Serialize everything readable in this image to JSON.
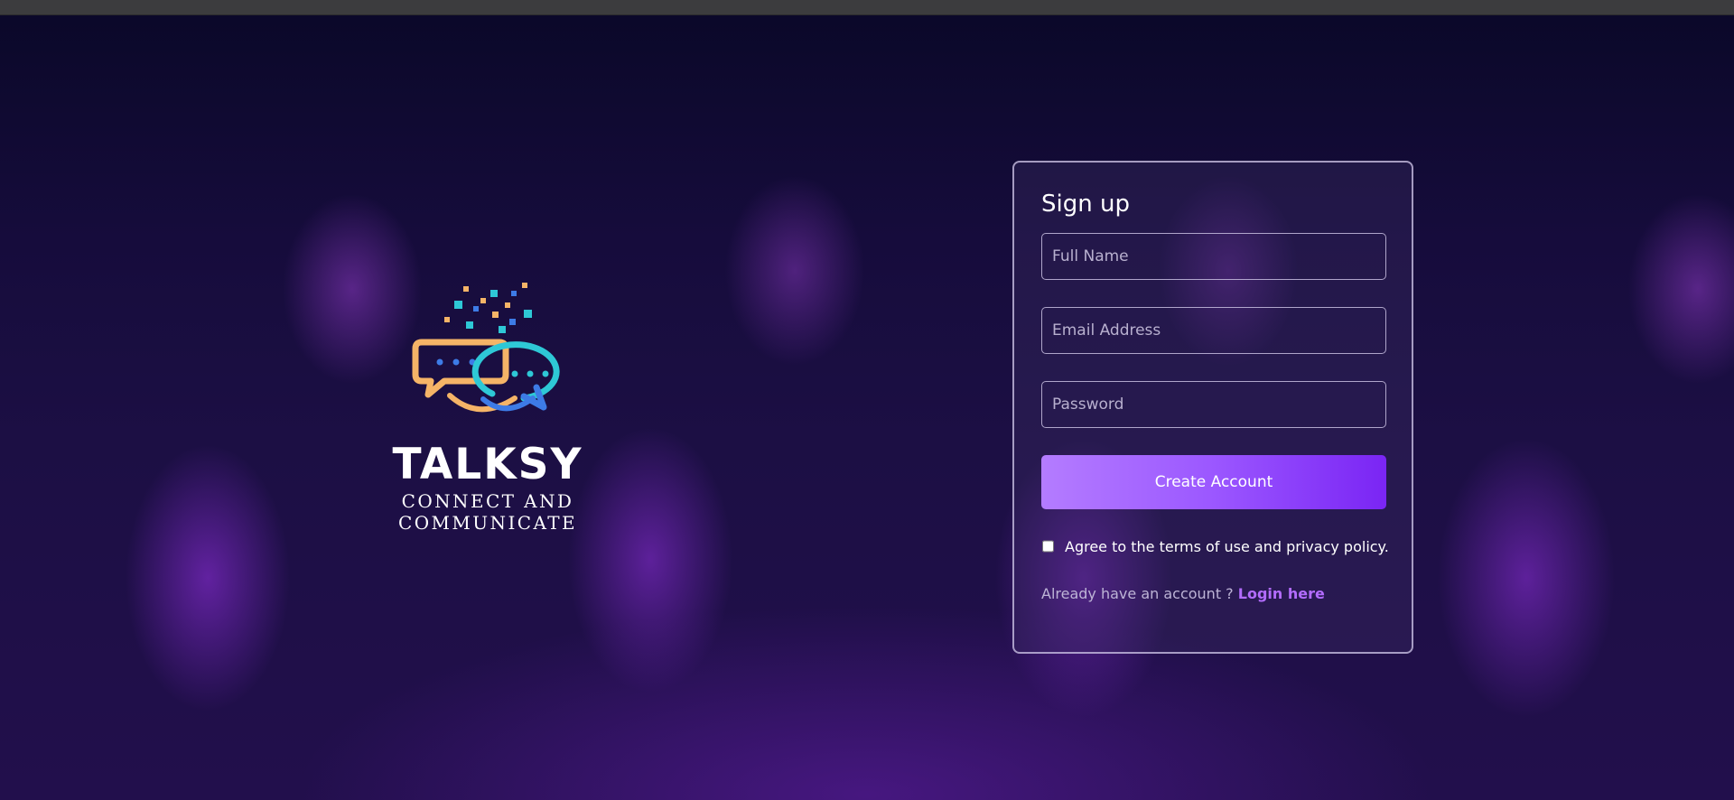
{
  "brand": {
    "name": "TALKSY",
    "tagline": "CONNECT AND COMMUNICATE"
  },
  "form": {
    "title": "Sign up",
    "full_name_placeholder": "Full Name",
    "email_placeholder": "Email Address",
    "password_placeholder": "Password",
    "submit_label": "Create Account",
    "agree_label": "Agree to the terms of use and privacy policy.",
    "login_prompt": "Already have an account ? ",
    "login_link": "Login here"
  },
  "colors": {
    "accent": "#9b57ff",
    "link": "#b36cff",
    "logo_orange": "#f5b467",
    "logo_cyan": "#2ec8d6",
    "logo_blue": "#3d7be6"
  },
  "icons": {
    "logo": "chat-bubbles-icon"
  }
}
